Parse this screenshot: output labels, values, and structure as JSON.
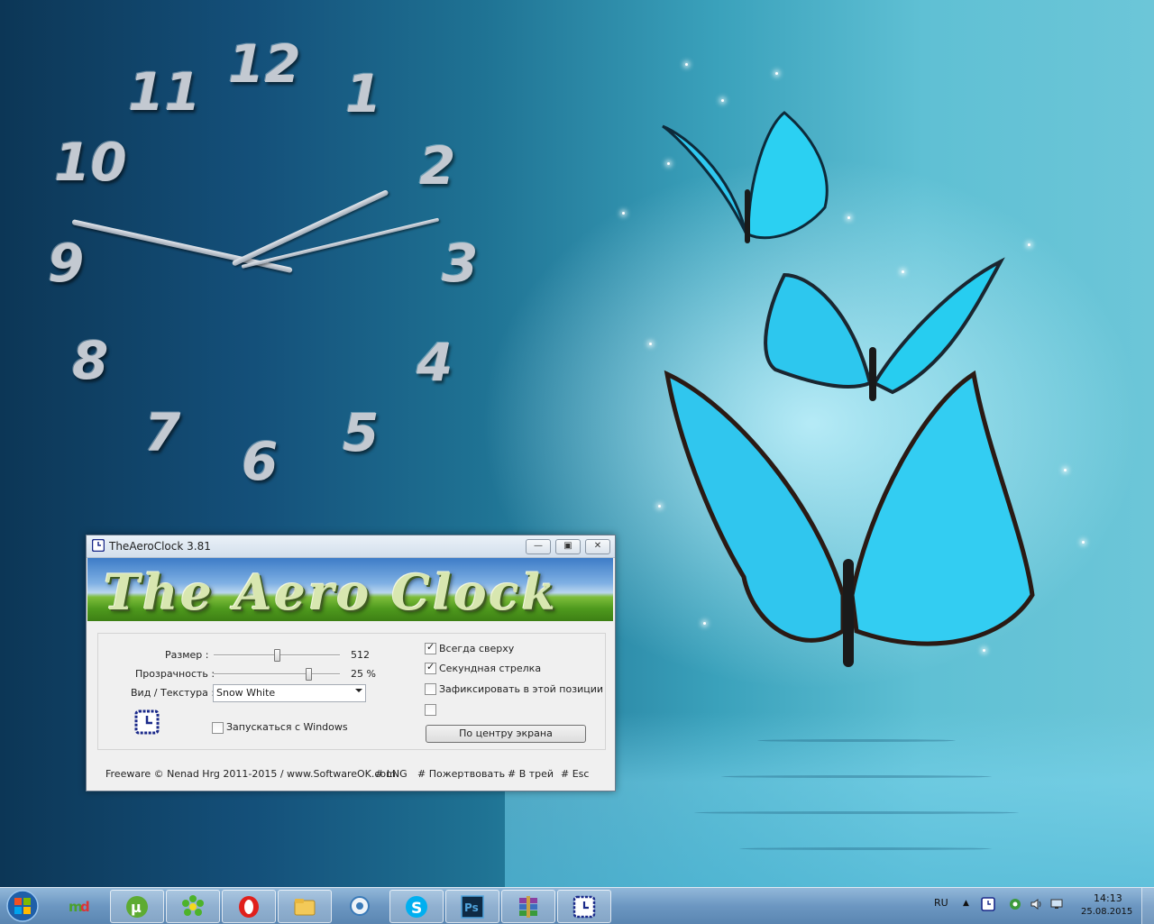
{
  "clock": {
    "numerals": [
      "12",
      "1",
      "2",
      "3",
      "4",
      "5",
      "6",
      "7",
      "8",
      "9",
      "10",
      "11"
    ]
  },
  "window": {
    "title": "TheAeroClock 3.81",
    "banner_text": "The Aero Clock",
    "controls": {
      "minimize": "▭",
      "maximize": "▭",
      "close": "✕"
    },
    "size_label": "Размер :",
    "size_value": "512",
    "size_fraction": 0.5,
    "transparency_label": "Прозрачность :",
    "transparency_value": "25 %",
    "transparency_fraction": 0.75,
    "texture_label": "Вид / Текстура :",
    "texture_selected": "Snow White",
    "autostart_label": "Запускаться с Windows",
    "always_on_top_label": "Всегда сверху",
    "second_hand_label": "Секундная стрелка",
    "lock_position_label": "Зафиксировать в этой позиции",
    "center_button_label": "По центру экрана",
    "footer": {
      "copyright": "Freeware © Nenad Hrg 2011-2015 / www.SoftwareOK.com",
      "lng": "# LNG",
      "donate": "# Пожертвовать",
      "tray": "# В трей",
      "esc": "# Esc"
    }
  },
  "taskbar": {
    "apps": [
      "mydesktop",
      "utorrent",
      "icq",
      "opera",
      "file-explorer",
      "media",
      "skype",
      "photoshop",
      "winrar",
      "theaeroclock"
    ],
    "tray": {
      "lang": "RU",
      "time": "14:13",
      "date": "25.08.2015"
    }
  }
}
